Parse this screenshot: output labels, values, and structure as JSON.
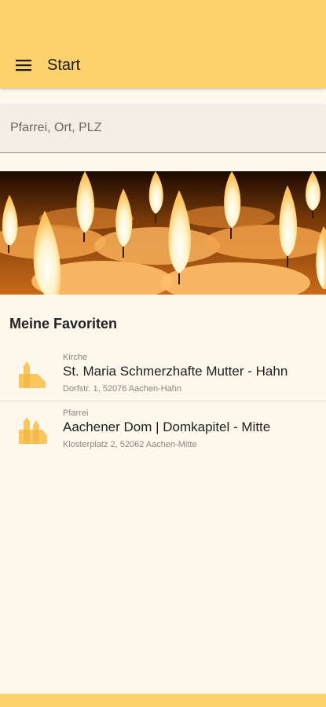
{
  "colors": {
    "accent": "#fdd26e",
    "background": "#fdf8ec",
    "icon": "#f9c660"
  },
  "app_bar": {
    "title": "Start",
    "menu_icon": "hamburger-menu-icon"
  },
  "search": {
    "placeholder": "Pfarrei, Ort, PLZ",
    "value": ""
  },
  "hero": {
    "image": "candles-photo"
  },
  "favorites": {
    "title": "Meine Favoriten",
    "items": [
      {
        "type": "Kirche",
        "name": "St. Maria Schmerzhafte Mutter - Hahn",
        "address": "Dorfstr. 1, 52076 Aachen-Hahn",
        "icon": "church-icon"
      },
      {
        "type": "Pfarrei",
        "name": "Aachener Dom | Domkapitel - Mitte",
        "address": "Klosterplatz 2, 52062 Aachen-Mitte",
        "icon": "parish-icon"
      }
    ]
  }
}
